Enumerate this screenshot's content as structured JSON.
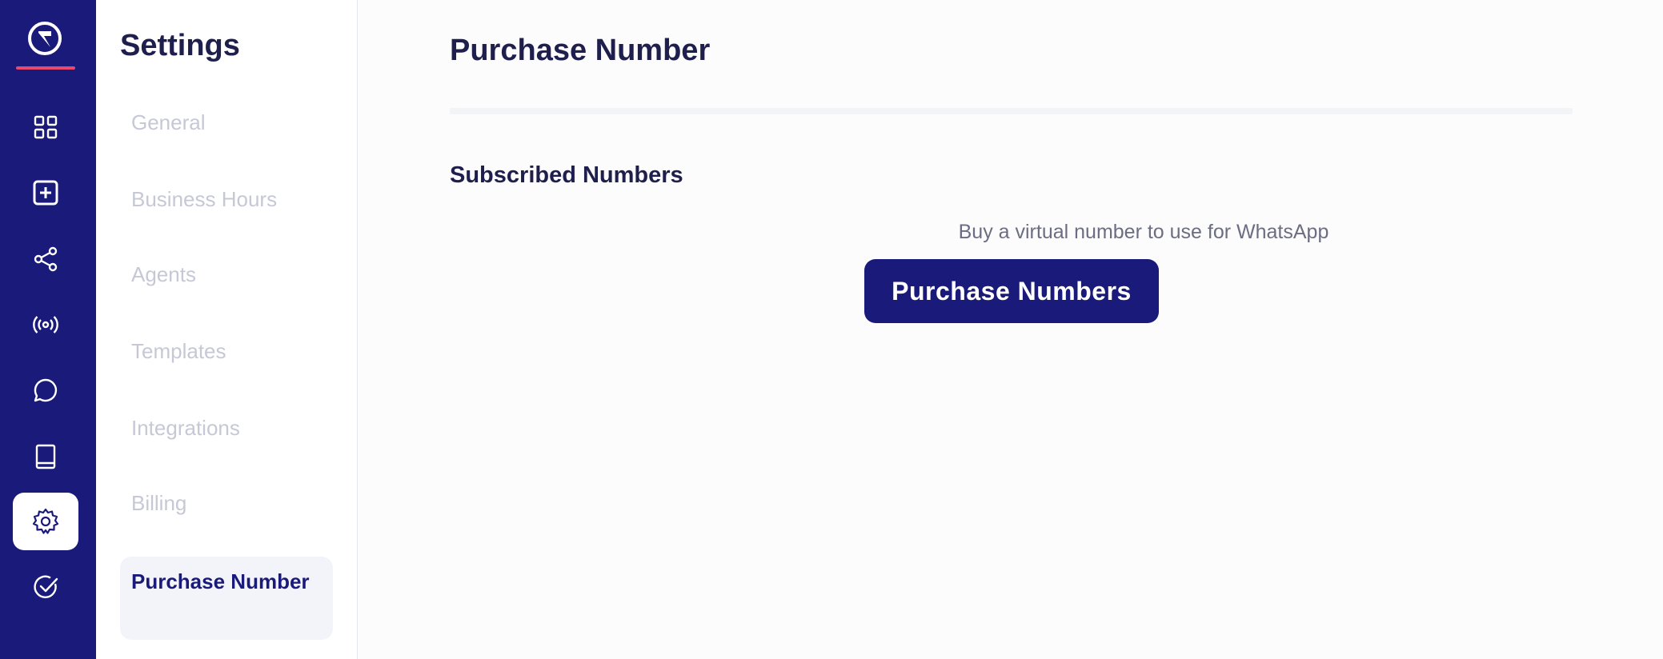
{
  "rail": {
    "items": [
      {
        "icon": "dashboard-icon",
        "active": false
      },
      {
        "icon": "add-square-icon",
        "active": false
      },
      {
        "icon": "share-icon",
        "active": false
      },
      {
        "icon": "broadcast-icon",
        "active": false
      },
      {
        "icon": "chat-icon",
        "active": false
      },
      {
        "icon": "book-icon",
        "active": false
      },
      {
        "icon": "gear-icon",
        "active": true
      },
      {
        "icon": "check-circle-icon",
        "active": false
      }
    ],
    "colors": {
      "background": "#1a1a7a",
      "logo_underline": "#e8476e"
    }
  },
  "settings_nav": {
    "title": "Settings",
    "items": [
      {
        "label": "General",
        "active": false
      },
      {
        "label": "Business Hours",
        "active": false
      },
      {
        "label": "Agents",
        "active": false
      },
      {
        "label": "Templates",
        "active": false
      },
      {
        "label": "Integrations",
        "active": false
      },
      {
        "label": "Billing",
        "active": false
      },
      {
        "label": "Purchase Number",
        "active": true
      }
    ]
  },
  "main": {
    "title": "Purchase Number",
    "section_title": "Subscribed Numbers",
    "helper_text": "Buy a virtual number to use for WhatsApp",
    "primary_button": "Purchase Numbers"
  }
}
